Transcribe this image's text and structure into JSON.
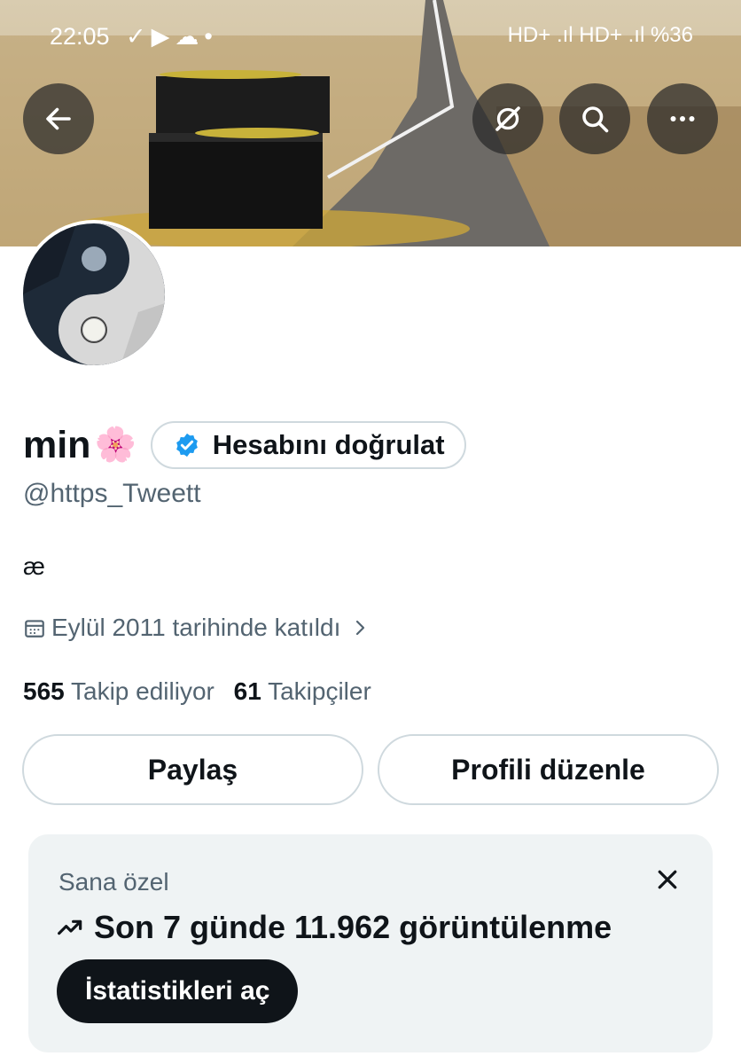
{
  "status_bar": {
    "time": "22:05",
    "left_icons": "✓▶☁•",
    "right_text": "HD+ .ıl HD+ .ıl %36"
  },
  "banner": {
    "description_icon": "banner-image"
  },
  "header_actions": {
    "back_icon": "arrow-left-icon",
    "grok_icon": "grok-icon",
    "search_icon": "search-icon",
    "more_icon": "more-icon"
  },
  "profile": {
    "name": "min",
    "name_emoji": "🌸",
    "verify_label": "Hesabını doğrulat",
    "handle": "@https_Tweett",
    "bio": "æ",
    "joined": "Eylül 2011 tarihinde katıldı",
    "following_count": "565",
    "following_label": "Takip ediliyor",
    "followers_count": "61",
    "followers_label": "Takipçiler"
  },
  "actions": {
    "share_label": "Paylaş",
    "edit_label": "Profili düzenle"
  },
  "insights_card": {
    "label": "Sana özel",
    "headline": "Son 7 günde 11.962 görüntülenme",
    "button_label": "İstatistikleri aç"
  }
}
